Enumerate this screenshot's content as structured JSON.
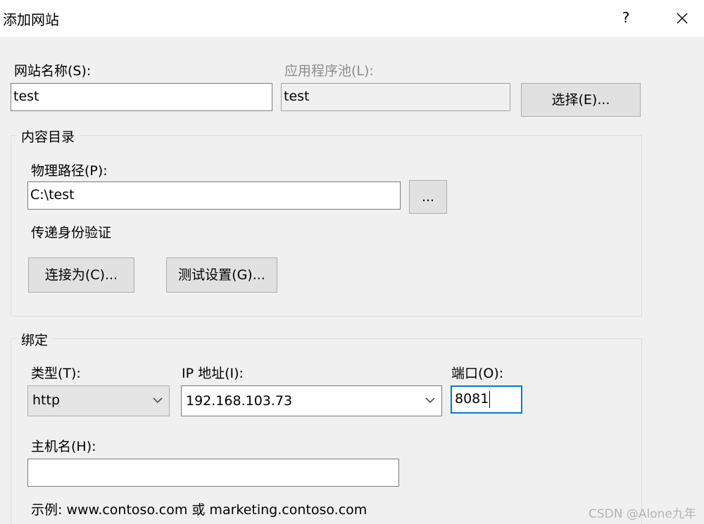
{
  "window": {
    "title": "添加网站",
    "help_glyph": "?",
    "close_label": "×"
  },
  "site": {
    "name_label": "网站名称(S):",
    "name_value": "test",
    "pool_label": "应用程序池(L):",
    "pool_value": "test",
    "select_button": "选择(E)..."
  },
  "content_dir": {
    "group_title": "内容目录",
    "path_label": "物理路径(P):",
    "path_value": "C:\\test",
    "browse_button": "...",
    "auth_label": "传递身份验证",
    "connect_as_button": "连接为(C)...",
    "test_settings_button": "测试设置(G)..."
  },
  "binding": {
    "group_title": "绑定",
    "type_label": "类型(T):",
    "type_value": "http",
    "ip_label": "IP 地址(I):",
    "ip_value": "192.168.103.73",
    "port_label": "端口(O):",
    "port_value": "8081",
    "host_label": "主机名(H):",
    "host_value": "",
    "example_text": "示例: www.contoso.com 或 marketing.contoso.com"
  },
  "watermark": "CSDN @Alone九年",
  "colors": {
    "dialog_background": "#f0f0f0",
    "focus_border": "#0078d7",
    "disabled_text": "#8c8c8c"
  }
}
